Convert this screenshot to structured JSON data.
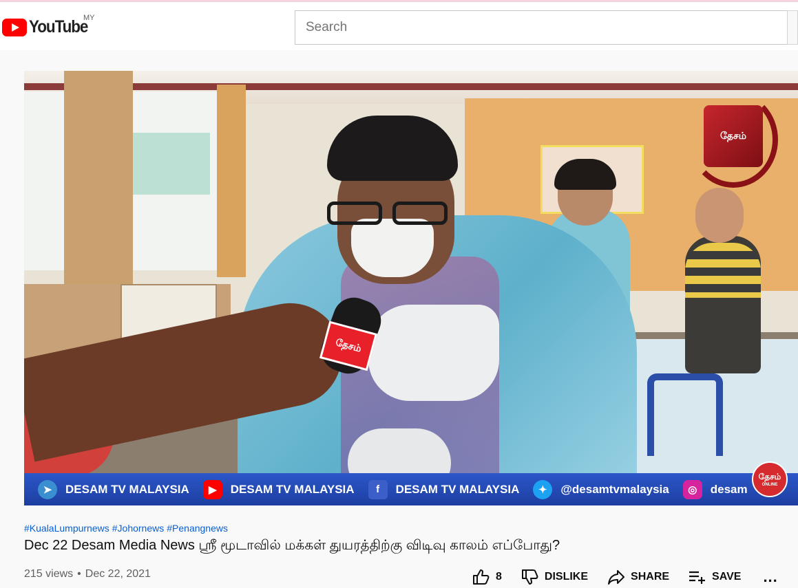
{
  "header": {
    "logo_text": "YouTube",
    "country_code": "MY",
    "search_placeholder": "Search"
  },
  "video": {
    "ticker": [
      {
        "icon": "telegram-icon",
        "label": "DESAM TV MALAYSIA",
        "color": "#3a8fd1"
      },
      {
        "icon": "youtube-icon",
        "label": "DESAM TV MALAYSIA",
        "color": "#ff0000"
      },
      {
        "icon": "facebook-icon",
        "label": "DESAM TV MALAYSIA",
        "color": "#2b57c9"
      },
      {
        "icon": "twitter-icon",
        "label": "@desamtvmalaysia",
        "color": "#1da1f2"
      },
      {
        "icon": "instagram-icon",
        "label": "desam",
        "color": "#d6249f"
      }
    ],
    "watermark_text": "தேசம்",
    "corner_logo_text": "தேசம்",
    "corner_logo_sub": "ONLINE",
    "mic_flag_text": "தேசம்"
  },
  "info": {
    "hashtags": [
      "#KualaLumpurnews",
      "#Johornews",
      "#Penangnews"
    ],
    "title": "Dec 22 Desam Media News ஸ்ரீ மூடாவில் மக்கள் துயரத்திற்கு விடிவு காலம் எப்போது?",
    "views": "215 views",
    "separator": "•",
    "date": "Dec 22, 2021"
  },
  "actions": {
    "like_count": "8",
    "dislike_label": "DISLIKE",
    "share_label": "SHARE",
    "save_label": "SAVE",
    "more_label": "..."
  }
}
